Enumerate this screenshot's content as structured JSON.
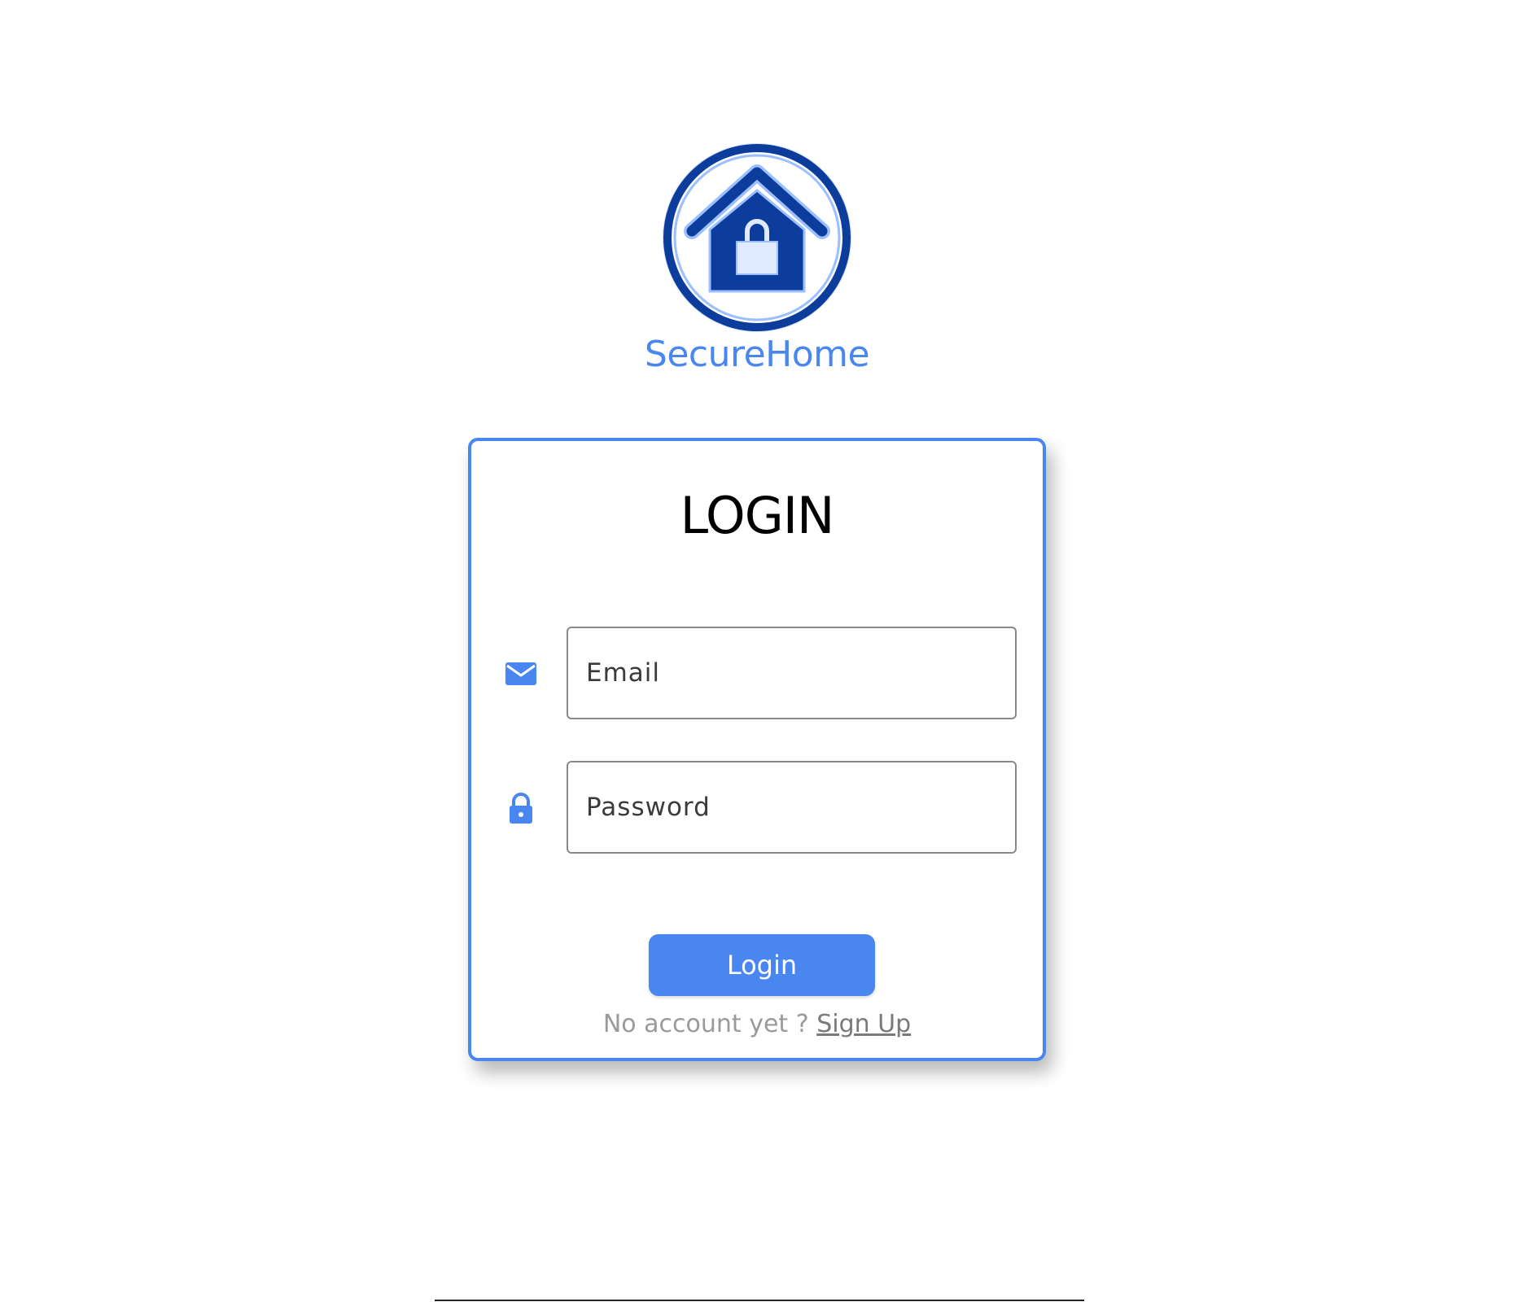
{
  "brand": {
    "name": "SecureHome",
    "color": "#4a86f0",
    "logo_icon": "house-lock-icon"
  },
  "login_card": {
    "title": "LOGIN",
    "accent_color": "#4a86f0",
    "email": {
      "icon": "mail-icon",
      "placeholder": "Email",
      "value": ""
    },
    "password": {
      "icon": "lock-icon",
      "placeholder": "Password",
      "value": ""
    },
    "login_button_label": "Login",
    "signup_prompt": "No account yet ?",
    "signup_link_label": "Sign Up"
  }
}
